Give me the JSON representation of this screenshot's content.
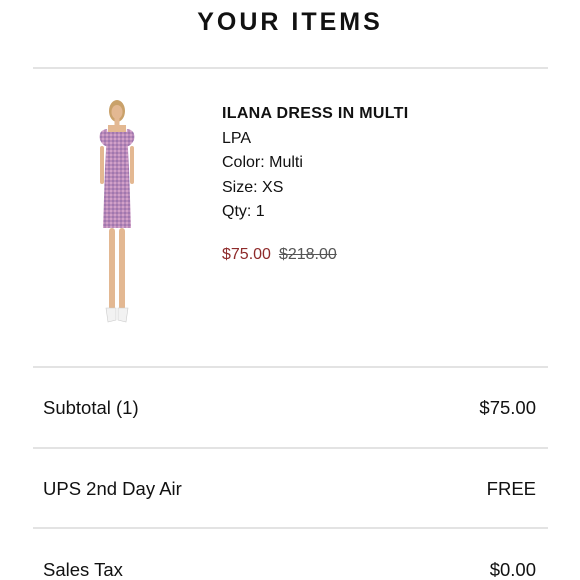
{
  "page": {
    "title": "YOUR ITEMS"
  },
  "item": {
    "name": "ILANA DRESS IN MULTI",
    "brand": "LPA",
    "color": "Color: Multi",
    "size": "Size: XS",
    "qty": "Qty: 1",
    "sale_price": "$75.00",
    "original_price": "$218.00"
  },
  "summary": {
    "subtotal_label": "Subtotal (1)",
    "subtotal_value": "$75.00",
    "shipping_label": "UPS 2nd Day Air",
    "shipping_value": "FREE",
    "tax_label": "Sales Tax",
    "tax_value": "$0.00"
  },
  "colors": {
    "sale_price": "#8e2a2a",
    "divider": "#e3e3e3"
  }
}
